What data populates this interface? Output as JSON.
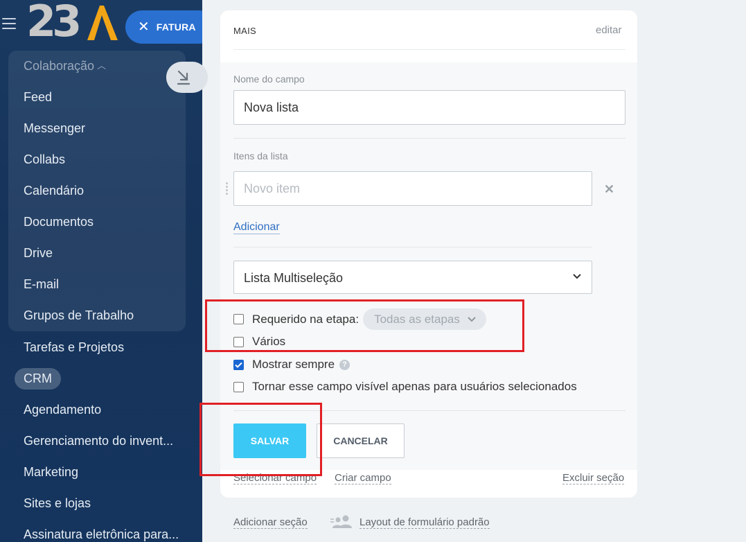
{
  "sidebar": {
    "logo_text": "23",
    "invoice_button": "FATURA",
    "group_title": "Colaboração",
    "items": [
      {
        "label": "Feed"
      },
      {
        "label": "Messenger"
      },
      {
        "label": "Collabs"
      },
      {
        "label": "Calendário"
      },
      {
        "label": "Documentos"
      },
      {
        "label": "Drive"
      },
      {
        "label": "E-mail"
      },
      {
        "label": "Grupos de Trabalho"
      },
      {
        "label": "Tarefas e Projetos"
      },
      {
        "label": "CRM"
      },
      {
        "label": "Agendamento"
      },
      {
        "label": "Gerenciamento do invent..."
      },
      {
        "label": "Marketing"
      },
      {
        "label": "Sites e lojas"
      },
      {
        "label": "Assinatura eletrônica para..."
      }
    ]
  },
  "section": {
    "title": "MAIS",
    "edit_link": "editar"
  },
  "field_editor": {
    "name_label": "Nome do campo",
    "name_value": "Nova lista",
    "items_label": "Itens da lista",
    "item_placeholder": "Novo item",
    "add_link": "Adicionar",
    "type_value": "Lista Multiseleção",
    "required_label": "Requerido na etapa:",
    "required_checked": false,
    "stages_value": "Todas as etapas",
    "multiple_label": "Vários",
    "multiple_checked": false,
    "always_show_label": "Mostrar sempre",
    "always_show_checked": true,
    "visibility_label": "Tornar esse campo visível apenas para usuários selecionados",
    "visibility_checked": false,
    "save_button": "SALVAR",
    "cancel_button": "CANCELAR"
  },
  "card_footer": {
    "select_field": "Selecionar campo",
    "create_field": "Criar campo",
    "delete_section": "Excluir seção"
  },
  "page_footer": {
    "add_section": "Adicionar seção",
    "default_layout": "Layout de formulário padrão"
  },
  "colors": {
    "accent": "#3bc8f5",
    "link": "#2e6ec3",
    "checkbox": "#1967d2",
    "highlight": "#e02025",
    "sidebar": "#1a3a62"
  }
}
